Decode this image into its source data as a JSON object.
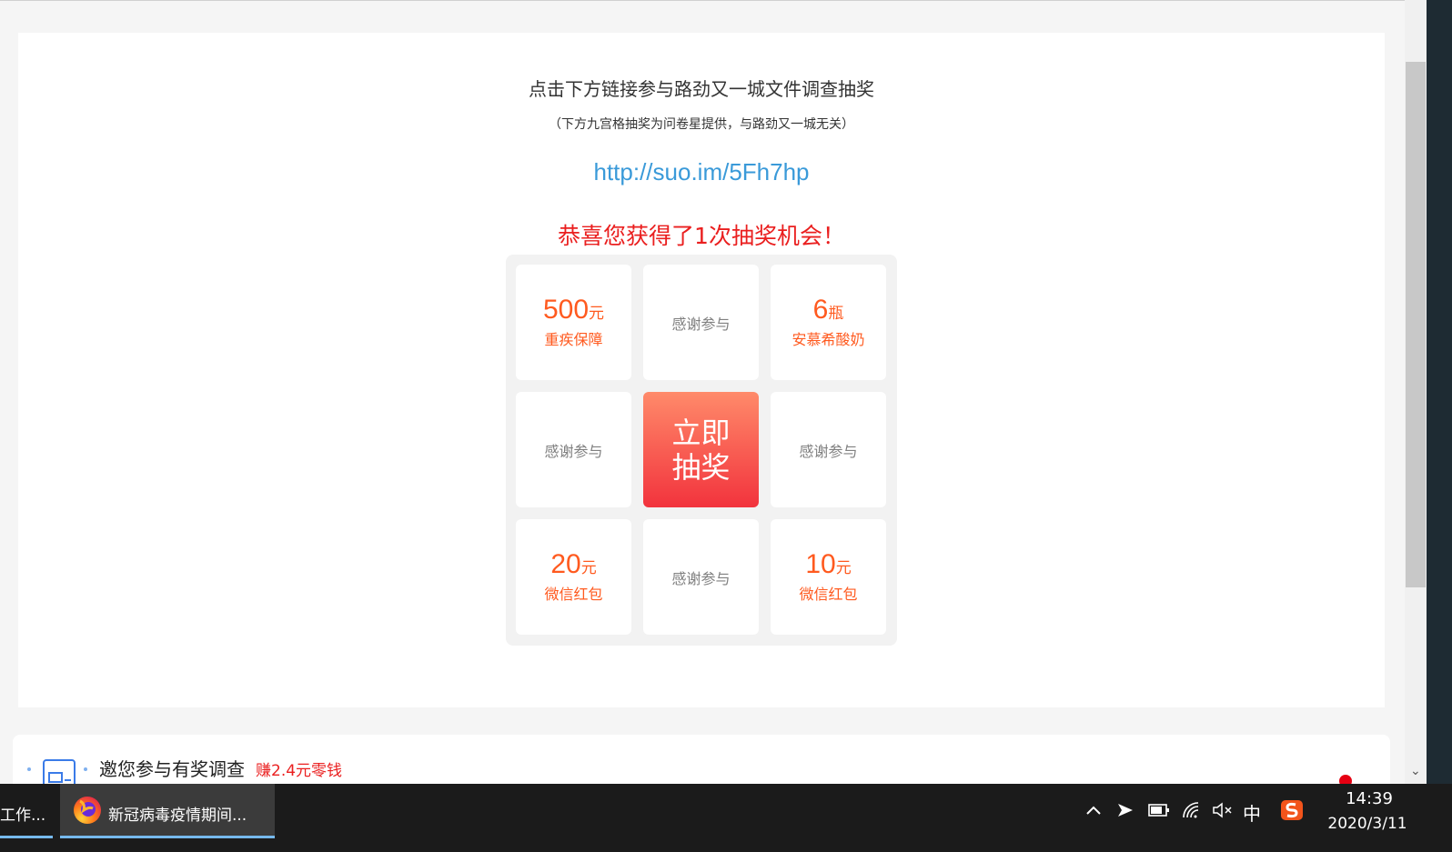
{
  "survey": {
    "title": "点击下方链接参与路劲又一城文件调查抽奖",
    "subtitle": "（下方九宫格抽奖为问卷星提供，与路劲又一城无关）",
    "link": "http://suo.im/5Fh7hp"
  },
  "lottery": {
    "congrats": "恭喜您获得了1次抽奖机会！",
    "draw_button": [
      "立即",
      "抽奖"
    ],
    "cells": [
      {
        "amount": "500",
        "unit": "元",
        "desc": "重疾保障"
      },
      {
        "thanks": "感谢参与"
      },
      {
        "amount": "6",
        "unit": "瓶",
        "desc": "安慕希酸奶"
      },
      {
        "thanks": "感谢参与"
      },
      {
        "button": true
      },
      {
        "thanks": "感谢参与"
      },
      {
        "amount": "20",
        "unit": "元",
        "desc": "微信红包"
      },
      {
        "thanks": "感谢参与"
      },
      {
        "amount": "10",
        "unit": "元",
        "desc": "微信红包"
      }
    ]
  },
  "invite": {
    "text": "邀您参与有奖调查",
    "earn": "赚2.4元零钱"
  },
  "taskbar": {
    "prev_task": "工作...",
    "active_task": "新冠病毒疫情期间...",
    "tray": {
      "input_method": "中",
      "time": "14:39",
      "date": "2020/3/11"
    }
  },
  "colors": {
    "accent_red": "#ea1f1f",
    "prize_orange": "#ff5a1f",
    "link_blue": "#3a9ad9"
  }
}
